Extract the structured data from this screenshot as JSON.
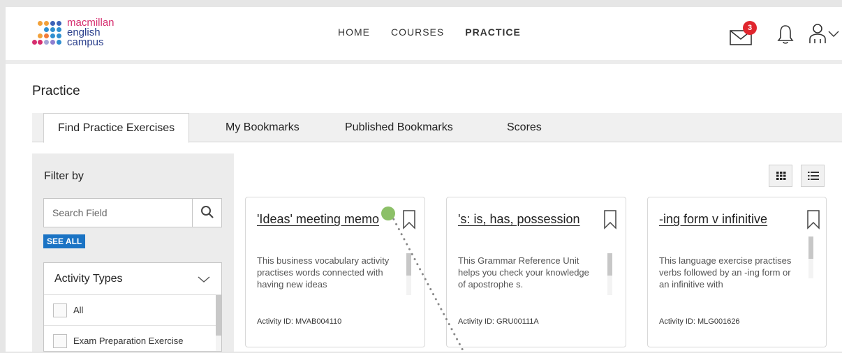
{
  "brand": {
    "line1": "macmillan",
    "line2": "english",
    "line3": "campus"
  },
  "nav": {
    "home": "HOME",
    "courses": "COURSES",
    "practice": "PRACTICE"
  },
  "notifications": {
    "mail_count": "3"
  },
  "page": {
    "title": "Practice"
  },
  "tabs": [
    {
      "label": "Find Practice Exercises"
    },
    {
      "label": "My Bookmarks"
    },
    {
      "label": "Published Bookmarks"
    },
    {
      "label": "Scores"
    }
  ],
  "sidebar": {
    "filter_title": "Filter by",
    "search_placeholder": "Search Field",
    "see_all": "SEE ALL",
    "activity_types": {
      "label": "Activity Types",
      "options": [
        {
          "label": "All"
        },
        {
          "label": "Exam Preparation Exercise"
        }
      ]
    }
  },
  "cards": [
    {
      "title": "'Ideas' meeting memo",
      "description": "This business vocabulary activity practises words connected with having new ideas",
      "activity_id": "Activity ID: MVAB004110"
    },
    {
      "title": "'s: is, has, possession",
      "description": "This Grammar Reference Unit helps you check your knowledge of apostrophe s.",
      "activity_id": "Activity ID: GRU00111A"
    },
    {
      "title": "-ing form v infinitive",
      "description": "This language exercise practises verbs followed by an -ing form or an infinitive with",
      "activity_id": "Activity ID: MLG001626"
    }
  ],
  "colors": {
    "accent_blue": "#1a73c4",
    "badge_red": "#e0262e",
    "cursor_green": "#8cc068"
  }
}
